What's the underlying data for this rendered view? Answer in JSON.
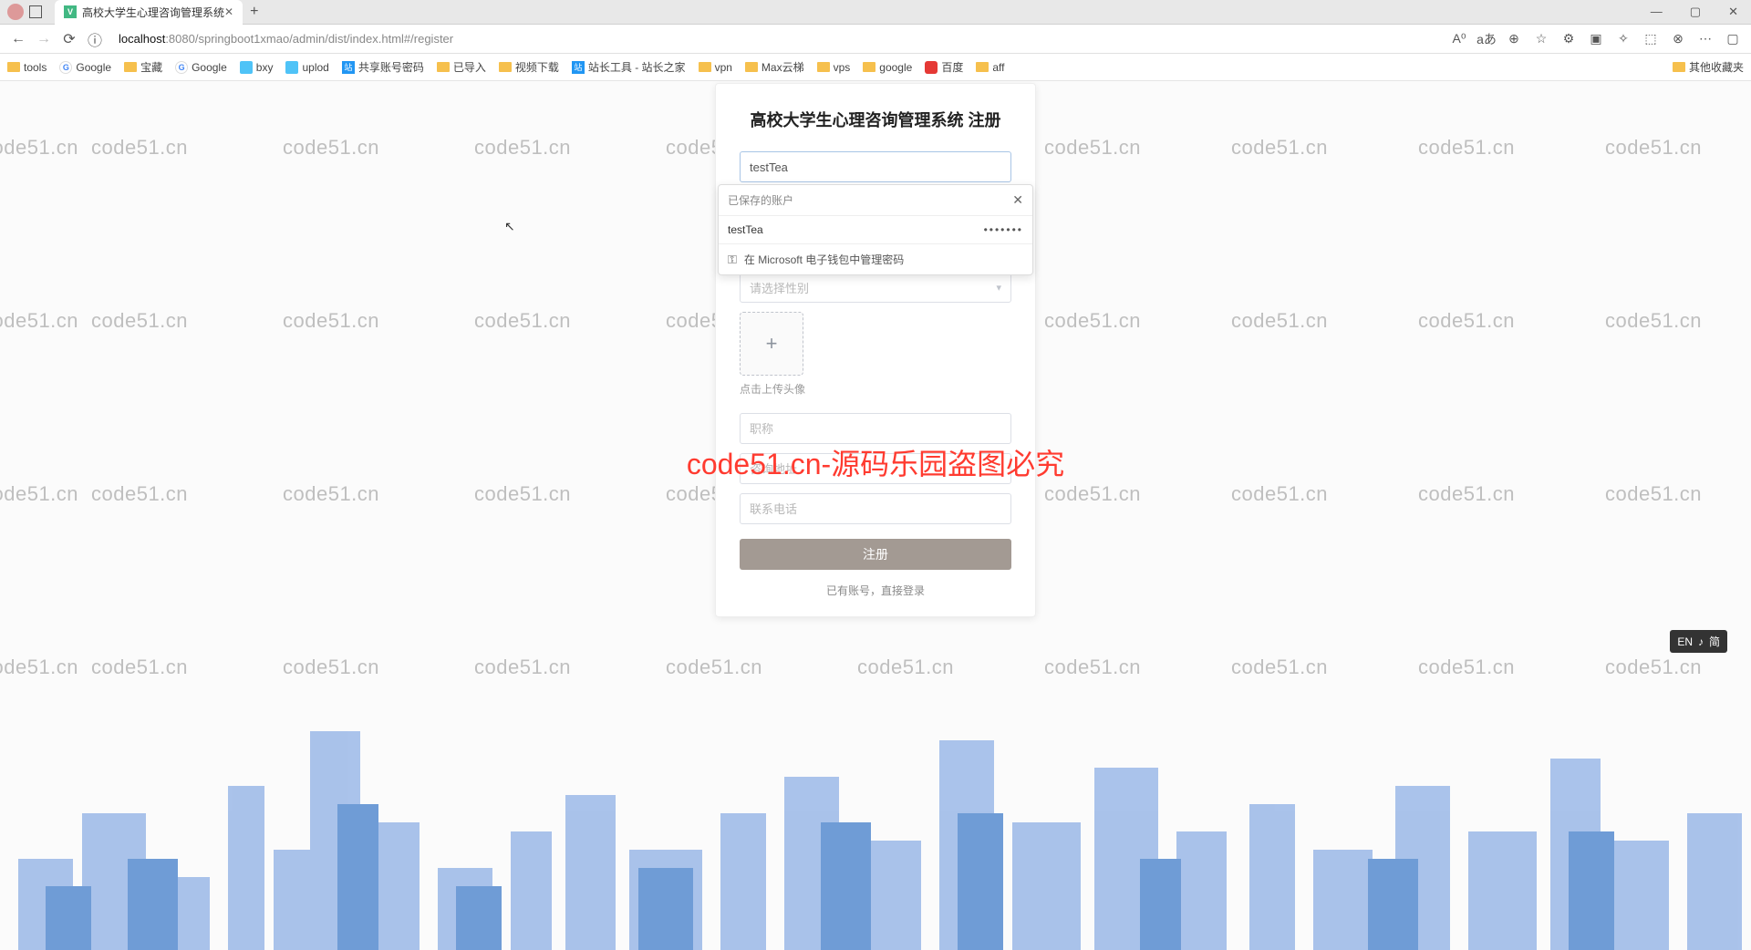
{
  "browser": {
    "tab_title": "高校大学生心理咨询管理系统",
    "url_info_icon": "ⓘ",
    "url_host": "localhost",
    "url_port": ":8080",
    "url_path": "/springboot1xmao/admin/dist/index.html#/register",
    "right_icons": [
      "A⁰",
      "aあ",
      "⊕",
      "☆",
      "⚙",
      "▣",
      "✧",
      "⬚",
      "⊗",
      "⋯",
      "▢"
    ],
    "win_controls": {
      "min": "—",
      "max": "▢",
      "close": "✕"
    }
  },
  "bookmarks": [
    {
      "type": "folder",
      "label": "tools"
    },
    {
      "type": "google",
      "label": "Google"
    },
    {
      "type": "folder",
      "label": "宝藏"
    },
    {
      "type": "google",
      "label": "Google"
    },
    {
      "type": "bxy",
      "label": "bxy"
    },
    {
      "type": "bxy",
      "label": "uplod"
    },
    {
      "type": "jt",
      "label": "共享账号密码"
    },
    {
      "type": "folder",
      "label": "已导入"
    },
    {
      "type": "folder",
      "label": "视频下载"
    },
    {
      "type": "jt",
      "label": "站长工具 - 站长之家"
    },
    {
      "type": "folder",
      "label": "vpn"
    },
    {
      "type": "folder",
      "label": "Max云梯"
    },
    {
      "type": "folder",
      "label": "vps"
    },
    {
      "type": "folder",
      "label": "google"
    },
    {
      "type": "bear",
      "label": "百度"
    },
    {
      "type": "folder",
      "label": "aff"
    }
  ],
  "bookmarks_overflow": "其他收藏夹",
  "watermark_text": "code51.cn",
  "watermark_red": "code51.cn-源码乐园盗图必究",
  "card": {
    "title": "高校大学生心理咨询管理系统 注册",
    "username_value": "testTea",
    "select_placeholder": "请选择性别",
    "upload_plus": "+",
    "upload_tip": "点击上传头像",
    "field_placeholders": {
      "job": "职称",
      "address": "咨询地址",
      "phone": "联系电话"
    },
    "submit": "注册",
    "login_link": "已有账号，直接登录"
  },
  "autofill": {
    "header": "已保存的账户",
    "close": "✕",
    "item_user": "testTea",
    "item_pw": "•••••••",
    "footer": "在 Microsoft 电子钱包中管理密码",
    "key_icon": "⚿"
  },
  "ime": {
    "lang": "EN",
    "mode": "♪",
    "alt": "简"
  }
}
